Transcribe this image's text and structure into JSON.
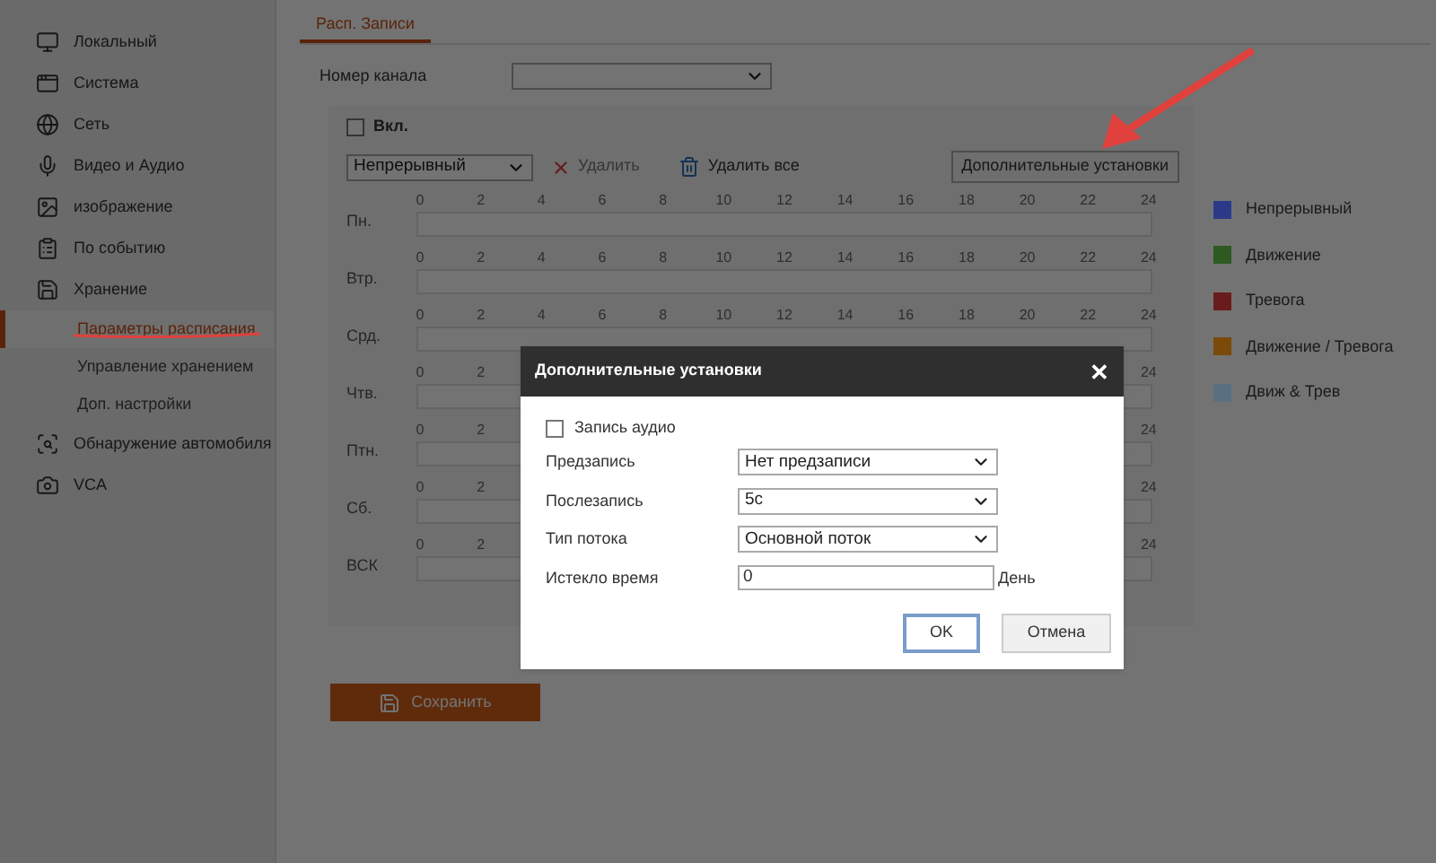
{
  "sidebar": {
    "items": [
      {
        "label": "Локальный"
      },
      {
        "label": "Система"
      },
      {
        "label": "Сеть"
      },
      {
        "label": "Видео и Аудио"
      },
      {
        "label": "изображение"
      },
      {
        "label": "По событию"
      },
      {
        "label": "Хранение",
        "children": [
          {
            "label": "Параметры расписания",
            "selected": true
          },
          {
            "label": "Управление хранением",
            "selected": false
          },
          {
            "label": "Доп. настройки",
            "selected": false
          }
        ]
      },
      {
        "label": "Обнаружение автомобиля"
      },
      {
        "label": "VCA"
      }
    ]
  },
  "tabs": [
    {
      "label": "Расп. Записи",
      "selected": true
    }
  ],
  "channel": {
    "label": "Номер канала"
  },
  "enable": {
    "label": "Вкл.",
    "checked": false
  },
  "toolbar": {
    "mode": "Непрерывный",
    "delete": {
      "label": "Удалить",
      "disabled": true
    },
    "delete_all": {
      "label": "Удалить все",
      "disabled": false
    },
    "advanced": "Дополнительные установки"
  },
  "schedule": {
    "days": [
      {
        "name": "Пн.",
        "ticks": [
          "0",
          "2",
          "4",
          "6",
          "8",
          "10",
          "12",
          "14",
          "16",
          "18",
          "20",
          "22",
          "24"
        ]
      },
      {
        "name": "Втр.",
        "ticks": [
          "0",
          "2",
          "4",
          "6",
          "8",
          "10",
          "12",
          "14",
          "16",
          "18",
          "20",
          "22",
          "24"
        ]
      },
      {
        "name": "Срд.",
        "ticks": [
          "0",
          "2",
          "4",
          "6",
          "8",
          "10",
          "12",
          "14",
          "16",
          "18",
          "20",
          "22",
          "24"
        ]
      },
      {
        "name": "Чтв.",
        "ticks": [
          "0",
          "2",
          "24"
        ]
      },
      {
        "name": "Птн.",
        "ticks": [
          "0",
          "2",
          "24"
        ]
      },
      {
        "name": "Сб.",
        "ticks": [
          "0",
          "2",
          "24"
        ]
      },
      {
        "name": "ВСК",
        "ticks": [
          "0",
          "2",
          "24"
        ]
      }
    ]
  },
  "legend": [
    {
      "label": "Непрерывный",
      "color": "#2b3a88"
    },
    {
      "label": "Движение",
      "color": "#2e5a22"
    },
    {
      "label": "Тревога",
      "color": "#6a1c1c"
    },
    {
      "label": "Движение / Тревога",
      "color": "#7a4a08"
    },
    {
      "label": "Движ & Трев",
      "color": "#5a7080"
    }
  ],
  "save_button": "Сохранить",
  "dialog": {
    "title": "Дополнительные установки",
    "close": "✕",
    "audio": {
      "label": "Запись аудио",
      "checked": false
    },
    "fields": [
      {
        "kind": "select",
        "label": "Предзапись",
        "value": "Нет предзаписи"
      },
      {
        "kind": "select",
        "label": "Послезапись",
        "value": "5с"
      },
      {
        "kind": "select",
        "label": "Тип потока",
        "value": "Основной поток"
      },
      {
        "kind": "input",
        "label": "Истекло время",
        "value": "0",
        "unit": "День"
      }
    ],
    "buttons": [
      {
        "label": "OK",
        "selected": true
      },
      {
        "label": "Отмена",
        "selected": false
      }
    ]
  }
}
